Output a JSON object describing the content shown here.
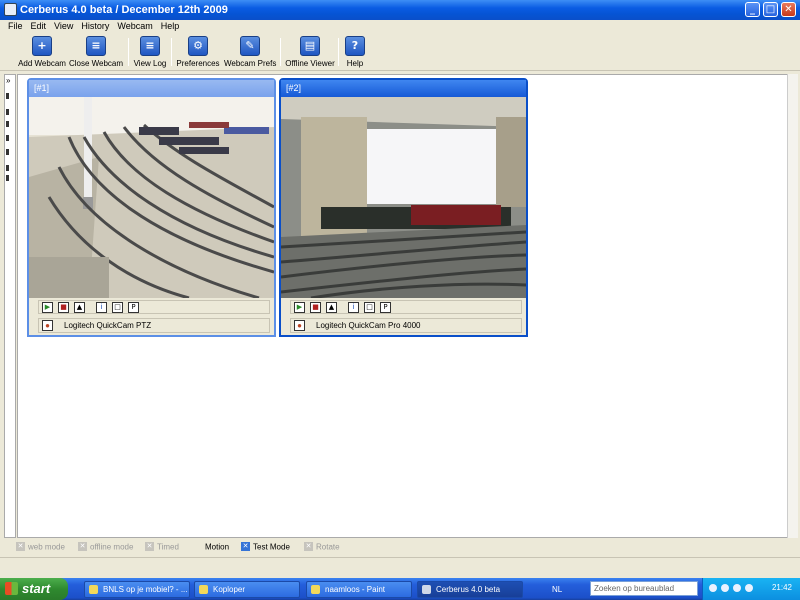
{
  "window": {
    "title": "Cerberus 4.0 beta / December 12th 2009"
  },
  "menu": [
    "File",
    "Edit",
    "View",
    "History",
    "Webcam",
    "Help"
  ],
  "toolbar": [
    {
      "label": "Add Webcam",
      "icon": "add-webcam-icon"
    },
    {
      "label": "Close Webcam",
      "icon": "close-webcam-icon"
    },
    {
      "label": "View Log",
      "icon": "log-icon"
    },
    {
      "label": "Preferences",
      "icon": "gear-icon"
    },
    {
      "label": "Webcam Prefs",
      "icon": "wrench-icon"
    },
    {
      "label": "Offline Viewer",
      "icon": "film-icon"
    },
    {
      "label": "Help",
      "icon": "help-icon"
    }
  ],
  "webcams": [
    {
      "id": "[#1]",
      "name": "Logitech QuickCam PTZ"
    },
    {
      "id": "[#2]",
      "name": "Logitech QuickCam Pro 4000"
    }
  ],
  "options": [
    {
      "label": "web mode",
      "checked": false
    },
    {
      "label": "offline mode",
      "checked": false
    },
    {
      "label": "Timed",
      "checked": false
    },
    {
      "label": "Motion"
    },
    {
      "label": "Test Mode",
      "checked": true
    },
    {
      "label": "Rotate",
      "checked": false
    }
  ],
  "taskbar": {
    "start": "start",
    "tasks": [
      "BNLS op je mobiel? - ...",
      "Koploper",
      "naamloos - Paint",
      "Cerberus 4.0 beta"
    ],
    "lang": "NL",
    "search_placeholder": "Zoeken op bureaublad",
    "clock": "21:42"
  },
  "colors": {
    "titlebar": "#0a5ce3",
    "taskbar": "#245edb",
    "start": "#3a9a3a",
    "panel_active": "#1659d6"
  }
}
